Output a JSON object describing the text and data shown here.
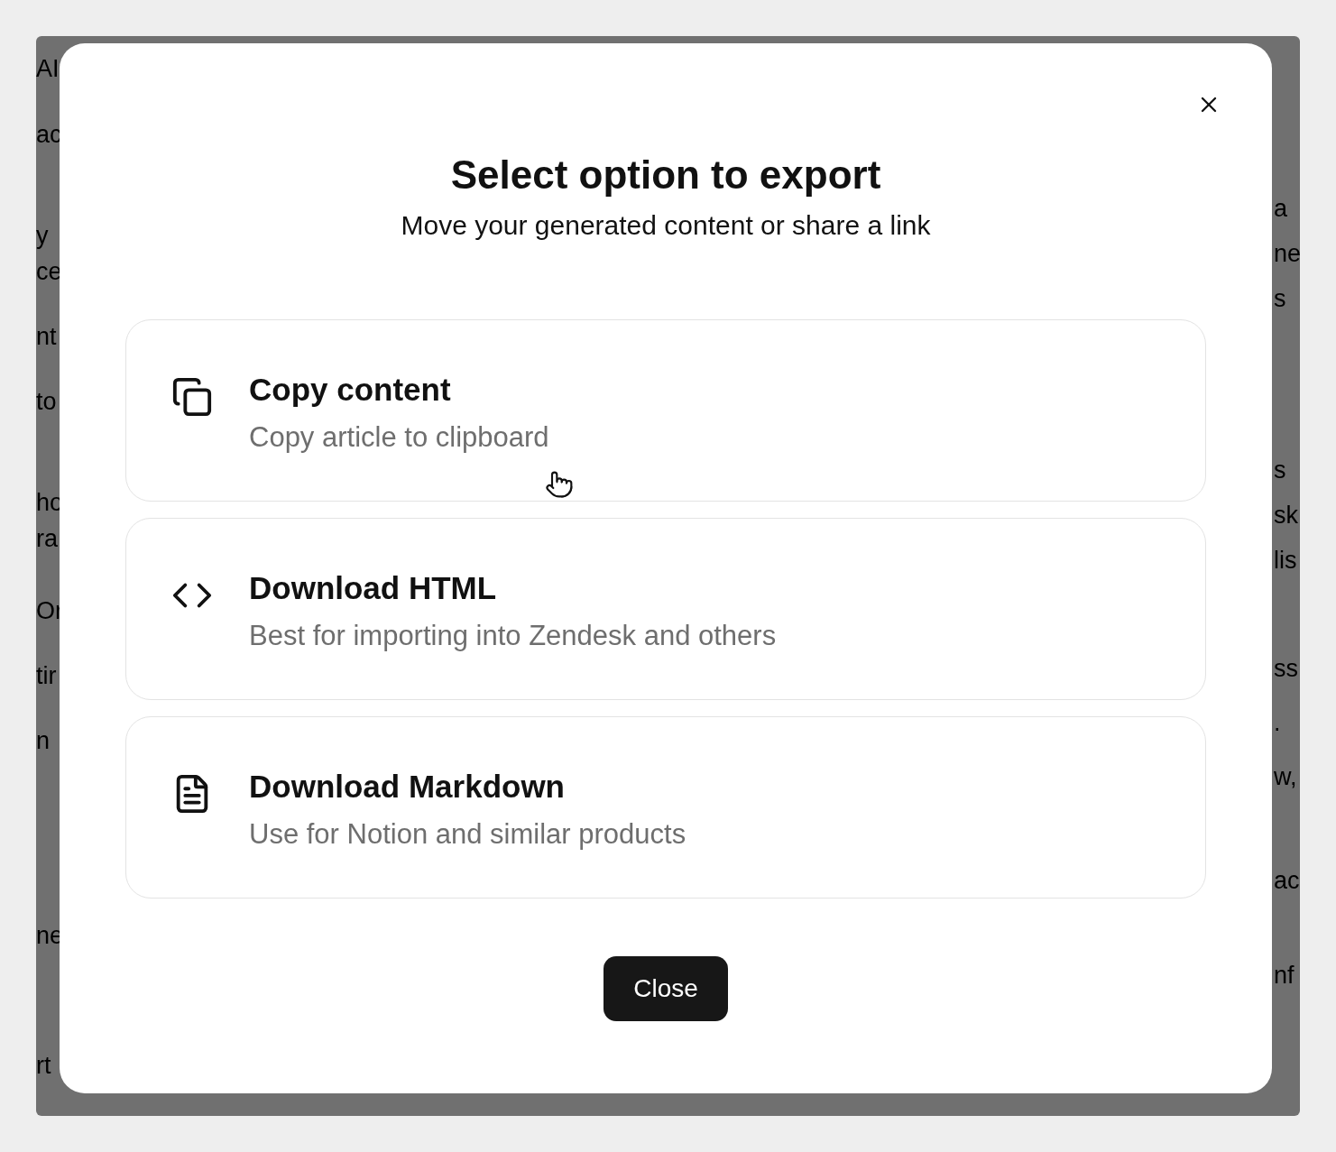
{
  "background": {
    "left_fragments": [
      "AI",
      "ac",
      "y",
      "ce",
      "nt",
      "to",
      "ho",
      "ra",
      "Or",
      "tir",
      "n",
      "ne",
      "rt"
    ],
    "right_fragments": [
      "a",
      "ne",
      "s",
      "s",
      "sk",
      "lis",
      "ss",
      ".",
      "w,",
      "ac",
      "nf"
    ]
  },
  "dialog": {
    "title": "Select option to export",
    "subtitle": "Move your generated content or share a link",
    "options": [
      {
        "title": "Copy content",
        "description": "Copy article to clipboard"
      },
      {
        "title": "Download HTML",
        "description": "Best for importing into Zendesk and others"
      },
      {
        "title": "Download Markdown",
        "description": "Use for Notion and similar products"
      }
    ],
    "close_button": "Close"
  }
}
